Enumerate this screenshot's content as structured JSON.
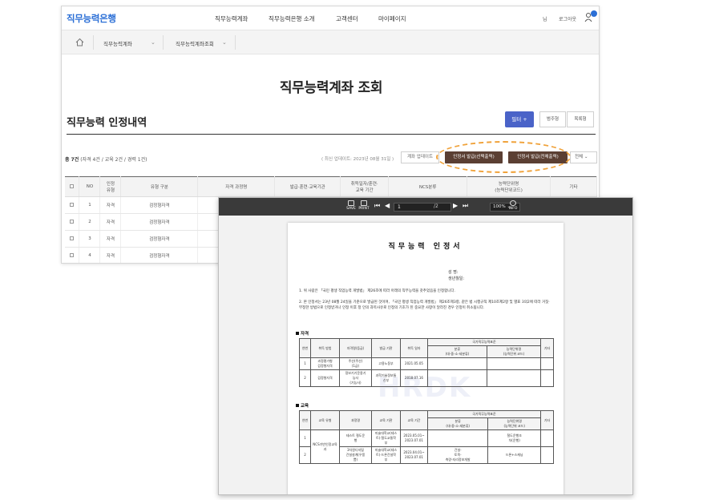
{
  "site": {
    "logo": "직무능력은행",
    "menu": [
      "직무능력계좌",
      "직무능력은행 소개",
      "고객센터",
      "마이페이지"
    ],
    "user_suffix": "님",
    "logout": "로그아웃",
    "breadcrumb": [
      "직무능력계좌",
      "직무능력계좌조회"
    ],
    "page_title": "직무능력계좌 조회",
    "section_title": "직무능력 인정내역",
    "filter_label": "필터 +",
    "legend_label": "범주형",
    "list_label": "목록형",
    "summary_total": "총 7건",
    "summary_detail": "(자격 4건 / 교육 2건 / 경력 1건)",
    "update_info": "( 최신 업데이트: 2023년 08월 31일 )",
    "update_btn": "계좌 업데이트",
    "issue_selected": "인정서 발급(선택출력)",
    "issue_all": "인정서 발급(전체출력)",
    "view_select": "전체",
    "accent_color": "#2b6fd6",
    "table": {
      "headers": [
        "",
        "NO",
        "인정\n유형",
        "유형 구분",
        "자격 과정명",
        "발급·훈련·교육기관",
        "취득일자/훈련·\n교육 기간",
        "NCS분류",
        "능력단위명\n(능력단위코드)",
        "기타"
      ],
      "rows": [
        {
          "no": "1",
          "type": "자격",
          "kind": "검정형자격"
        },
        {
          "no": "2",
          "type": "자격",
          "kind": "검정형자격"
        },
        {
          "no": "3",
          "type": "자격",
          "kind": "검정형자격"
        },
        {
          "no": "4",
          "type": "자격",
          "kind": "검정형자격"
        }
      ]
    }
  },
  "viewer": {
    "save": "SAVE",
    "print": "PRINT",
    "page_current": "1",
    "page_total": "/2",
    "zoom": "100%",
    "info": "INFO",
    "doc": {
      "title": "직무능력 인정서",
      "name_label": "성    명:",
      "birth_label": "생년월일:",
      "para1": "1.  위 사람은 「국민 평생 직업능력 개발법」 제26조에 따라 아래의 직무능력을 갖추었음을 인정합니다.",
      "para2": "2.  본 인정서는 23년 08월 24일을 기준으로 발급된 것이며, 「국민 평생 직업능력 개발법」 제26조제3항, 같은 법 시행규칙 제10조제2항 및 별표 3의2에 따라 거짓·부정한 방법으로 인정받거나 인정 이후 정 인의 과목사유로 인정의 기초가 된 중요한 사항이 달라진 경우 인정이 취소됩니다.",
      "section_qual": "자격",
      "section_edu": "교육",
      "watermark": "HRDK",
      "qual_headers": [
        "연번",
        "취득 방법",
        "자격명(등급)",
        "발급 기관",
        "취득 일자",
        "분류\n(대-중-소-세분류)",
        "능력단위명\n(능력단위 코드)",
        "기타"
      ],
      "qual_group": "국가직무능력표준",
      "qual_rows": [
        [
          "1",
          "과정평가형\n검정형자격",
          "주산(주산)\n(1급)",
          "고용노동부",
          "2021.05.05",
          "",
          "",
          ""
        ],
        [
          "2",
          "검정형자격",
          "정보기기운용기\n능사\n(기능사)",
          "과학기술정보통\n신부",
          "2018.07.16",
          "",
          "",
          ""
        ]
      ],
      "edu_headers": [
        "연번",
        "교육 유형",
        "과정명",
        "교육 기관",
        "교육 기간",
        "분류\n(대-중-소-세분류)",
        "능력단위명\n(능력단위 코드)",
        "기타"
      ],
      "edu_group": "국가직무능력표준",
      "edu_type": "NCS기반인정교육\n과",
      "edu_rows": [
        [
          "1",
          "테스트 철도운\n행",
          "미술대학교(테스\n트)·철도교통학\n부",
          "2023.05.01~\n2023.07.01",
          "",
          "철도운행조\n차(운행)"
        ],
        [
          "2",
          "3차원디지털\n건설설계(우풍\n쁨)",
          "미술대학교(테스\n트)·드론건설학\n부",
          "2023.04.01~\n2023.07.01",
          "건설-\n토목-\n측량-지리정보개발",
          "드론+스캐닝"
        ]
      ]
    }
  }
}
